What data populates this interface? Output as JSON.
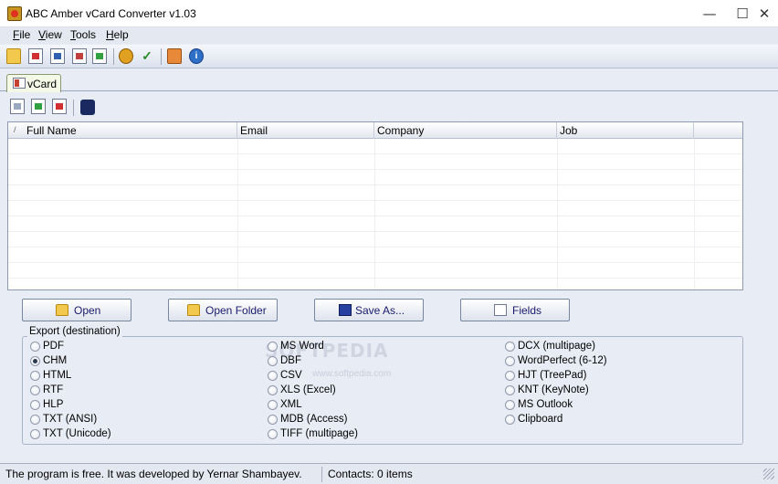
{
  "window": {
    "title": "ABC Amber vCard Converter v1.03",
    "minimize_glyph": "—",
    "maximize_glyph": "☐",
    "close_glyph": "✕"
  },
  "menu": {
    "items": [
      {
        "accel": "F",
        "rest": "ile"
      },
      {
        "accel": "V",
        "rest": "iew"
      },
      {
        "accel": "T",
        "rest": "ools"
      },
      {
        "accel": "H",
        "rest": "elp"
      }
    ]
  },
  "toolbar": {
    "icons": [
      "open-folder-icon",
      "pdf-icon",
      "chm-icon",
      "rtf-icon",
      "refresh-icon",
      "settings-icon",
      "spellcheck-icon",
      "home-icon",
      "info-icon"
    ],
    "info_glyph": "i",
    "check_glyph": "✓"
  },
  "tabs": [
    {
      "label": "vCard"
    }
  ],
  "subtoolbar": {
    "icons": [
      "new-list-icon",
      "add-row-icon",
      "remove-row-icon",
      "blackberry-icon"
    ]
  },
  "list": {
    "sort_glyph": "/",
    "columns": [
      "Full Name",
      "Email",
      "Company",
      "Job"
    ],
    "rows": []
  },
  "buttons": {
    "open": "Open",
    "open_folder": "Open Folder",
    "save_as": "Save As...",
    "fields": "Fields"
  },
  "export": {
    "title": "Export (destination)",
    "selected": "CHM",
    "col1": [
      "PDF",
      "CHM",
      "HTML",
      "RTF",
      "HLP",
      "TXT (ANSI)",
      "TXT (Unicode)"
    ],
    "col2": [
      "MS Word",
      "DBF",
      "CSV",
      "XLS (Excel)",
      "XML",
      "MDB (Access)",
      "TIFF (multipage)"
    ],
    "col3": [
      "DCX (multipage)",
      "WordPerfect (6-12)",
      "HJT (TreePad)",
      "KNT (KeyNote)",
      "MS Outlook",
      "Clipboard"
    ]
  },
  "watermark": {
    "main": "SOFTPEDIA",
    "sub": "www.softpedia.com"
  },
  "status": {
    "message": "The program is free. It was developed by Yernar Shambayev.",
    "contacts": "Contacts: 0 items"
  }
}
